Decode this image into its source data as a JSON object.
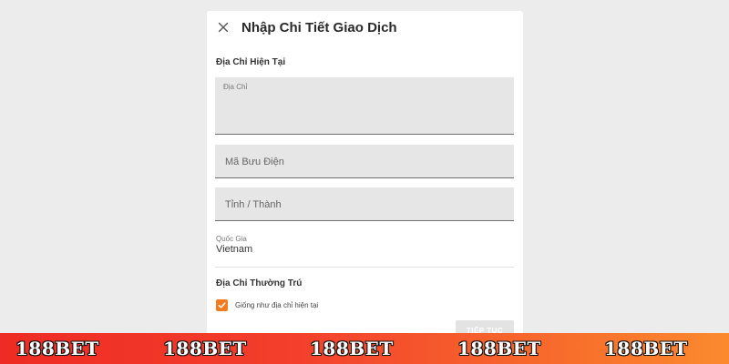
{
  "dialog": {
    "title": "Nhập Chi Tiết Giao Dịch",
    "close_icon": "close-icon"
  },
  "current_address": {
    "section_label": "Địa Chỉ Hiện Tại",
    "address_label": "Địa Chỉ",
    "address_value": "",
    "postal_code_placeholder": "Mã Bưu Điện",
    "province_placeholder": "Tỉnh / Thành",
    "country_label": "Quốc Gia",
    "country_value": "Vietnam"
  },
  "permanent_address": {
    "section_label": "Địa Chỉ Thường Trú",
    "same_as_current_label": "Giống như địa chỉ hiện tại",
    "same_as_current_checked": true
  },
  "actions": {
    "continue_label": "TIẾP TỤC"
  },
  "watermark": {
    "brand_items": [
      "188BET",
      "188BET",
      "188BET",
      "188BET",
      "188BET"
    ]
  },
  "colors": {
    "checkbox": "#f27c1f",
    "banner_start": "#ee2b24",
    "banner_end": "#fb8a2e",
    "field_background": "#e6e6e6"
  }
}
